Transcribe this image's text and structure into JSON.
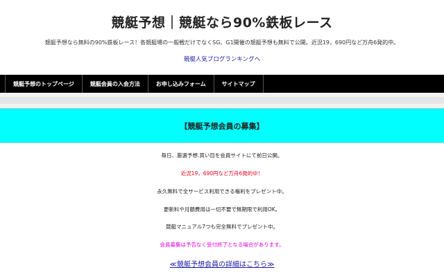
{
  "header": {
    "site_title": "競艇予想｜競艇なら90%鉄板レース",
    "description": "競艇予想なら無料の90%鉄板レース！各競艇場の一般戦だけでなくSG、G1開催の競艇予想も無料で公開。近況19，690円など万舟6発的中。",
    "ranking_link": "競艇人気ブログランキングへ"
  },
  "nav": {
    "items": [
      {
        "label": "競艇予想のトップページ"
      },
      {
        "label": "競艇会員の入会方法"
      },
      {
        "label": "お申し込みフォーム"
      },
      {
        "label": "サイトマップ"
      }
    ]
  },
  "main": {
    "banner_title": "【競艇予想会員の募集】",
    "lines": [
      {
        "text": "毎日、厳選予想.買い目を会員サイトにて前日公開。",
        "color": "#222222"
      },
      {
        "text": "近況19，690円など万舟6発的中！",
        "color": "#e8001c"
      },
      {
        "text": "永久無料で全サービス利用できる権利をプレゼント中。",
        "color": "#222222"
      },
      {
        "text": "更新料や月額費用は一切不要で無期限で利用OK。",
        "color": "#222222"
      },
      {
        "text": "競艇マニュアル7つも完全無料でプレゼント中。",
        "color": "#222222"
      },
      {
        "text": "会員募集は予告なく受付終了となる場合があります。",
        "color": "#e000e0"
      }
    ],
    "details_link": "≪競艇予想会員の詳細はこちら≫"
  },
  "colors": {
    "banner_bg": "#00ffff",
    "nav_bg": "#000000",
    "link": "#1a1aa6"
  }
}
